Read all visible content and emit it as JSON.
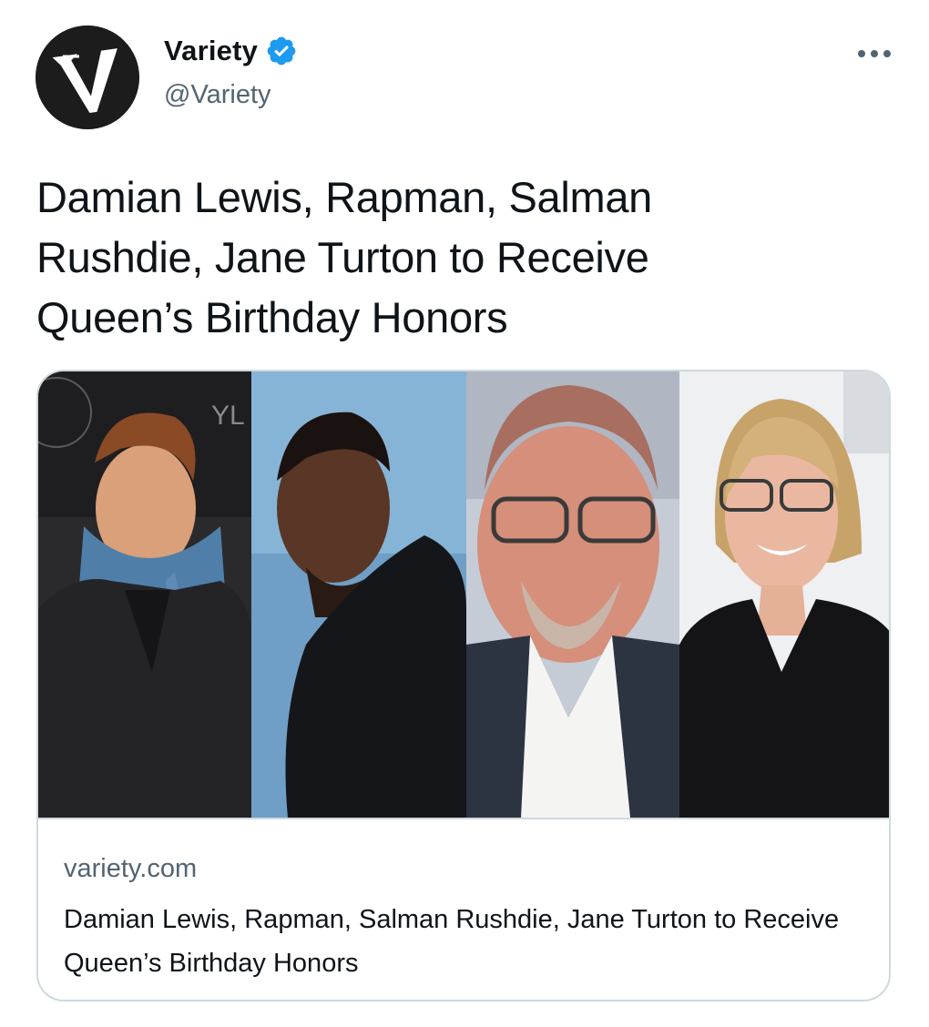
{
  "account": {
    "display_name": "Variety",
    "handle": "@Variety",
    "verified": true,
    "avatar_icon": "variety-v-logo-icon"
  },
  "actions": {
    "more_icon": "more-dots-icon"
  },
  "tweet": {
    "text": "Damian Lewis, Rapman, Salman Rushdie, Jane Turton to Receive Queen’s Birthday Honors"
  },
  "card": {
    "domain": "variety.com",
    "title": "Damian Lewis, Rapman, Salman Rushdie, Jane Turton to Receive Queen’s Birthday Honors",
    "image_description_icons": [
      "portrait-photo-icon",
      "portrait-photo-icon",
      "portrait-photo-icon",
      "portrait-photo-icon"
    ]
  },
  "colors": {
    "text_primary": "#0f1419",
    "text_secondary": "#536471",
    "verified_blue": "#1d9bf0",
    "card_border": "#cfd9de"
  }
}
